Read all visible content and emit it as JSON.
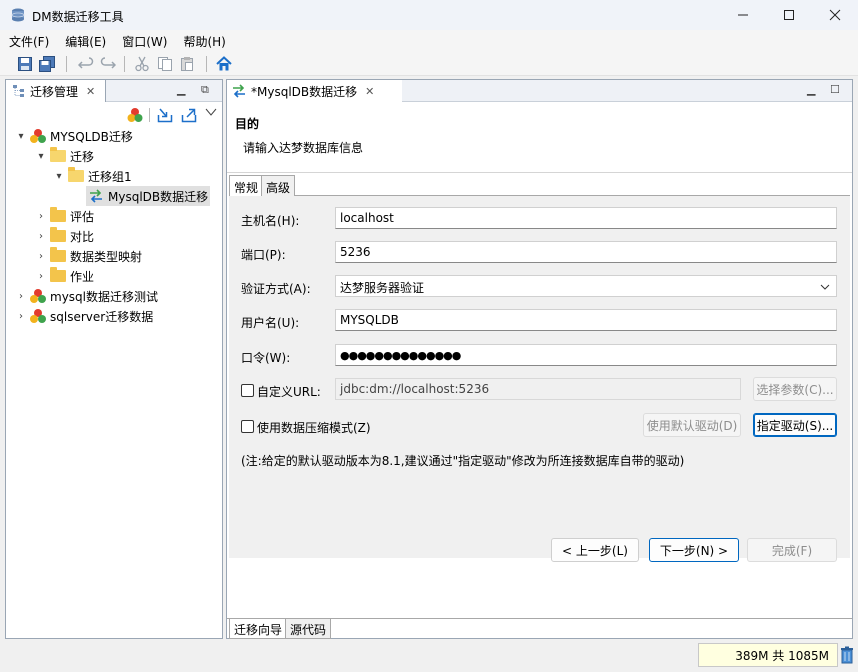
{
  "window": {
    "title": "DM数据迁移工具",
    "controls": [
      "—",
      "☐",
      "✕"
    ]
  },
  "menu": [
    "文件(F)",
    "编辑(E)",
    "窗口(W)",
    "帮助(H)"
  ],
  "left_panel": {
    "tab_label": "迁移管理",
    "tree": [
      {
        "label": "MYSQLDB迁移",
        "level": 0,
        "type": "db",
        "expanded": true
      },
      {
        "label": "迁移",
        "level": 1,
        "type": "folder-open",
        "expanded": true
      },
      {
        "label": "迁移组1",
        "level": 2,
        "type": "folder-open",
        "expanded": true
      },
      {
        "label": "MysqlDB数据迁移",
        "level": 3,
        "type": "migration",
        "selected": true
      },
      {
        "label": "评估",
        "level": 1,
        "type": "folder"
      },
      {
        "label": "对比",
        "level": 1,
        "type": "folder"
      },
      {
        "label": "数据类型映射",
        "level": 1,
        "type": "folder"
      },
      {
        "label": "作业",
        "level": 1,
        "type": "folder"
      },
      {
        "label": "mysql数据迁移测试",
        "level": 0,
        "type": "db"
      },
      {
        "label": "sqlserver迁移数据",
        "level": 0,
        "type": "db"
      }
    ]
  },
  "editor": {
    "tab_label": "*MysqlDB数据迁移",
    "header_title": "目的",
    "header_desc": "请输入达梦数据库信息",
    "subtabs": [
      "常规",
      "高级"
    ],
    "form": {
      "host_label": "主机名(H):",
      "host_value": "localhost",
      "port_label": "端口(P):",
      "port_value": "5236",
      "auth_label": "验证方式(A):",
      "auth_value": "达梦服务器验证",
      "user_label": "用户名(U):",
      "user_value": "MYSQLDB",
      "pwd_label": "口令(W):",
      "pwd_value": "●●●●●●●●●●●●●●",
      "custom_url_label": "自定义URL:",
      "url_value": "jdbc:dm://localhost:5236",
      "select_params_button": "选择参数(C)...",
      "compress_label": "使用数据压缩模式(Z)",
      "default_driver_button": "使用默认驱动(D)",
      "specify_driver_button": "指定驱动(S)...",
      "note": "(注:给定的默认驱动版本为8.1,建议通过\"指定驱动\"修改为所连接数据库自带的驱动)"
    },
    "nav": {
      "prev": "< 上一步(L)",
      "next": "下一步(N) >",
      "finish": "完成(F)"
    },
    "bottom_tabs": [
      "迁移向导",
      "源代码"
    ]
  },
  "status": {
    "memory": "389M 共 1085M"
  },
  "colors": {
    "accent": "#0067c0",
    "folder": "#f3c44b",
    "memory_bg": "#ffffe0"
  }
}
